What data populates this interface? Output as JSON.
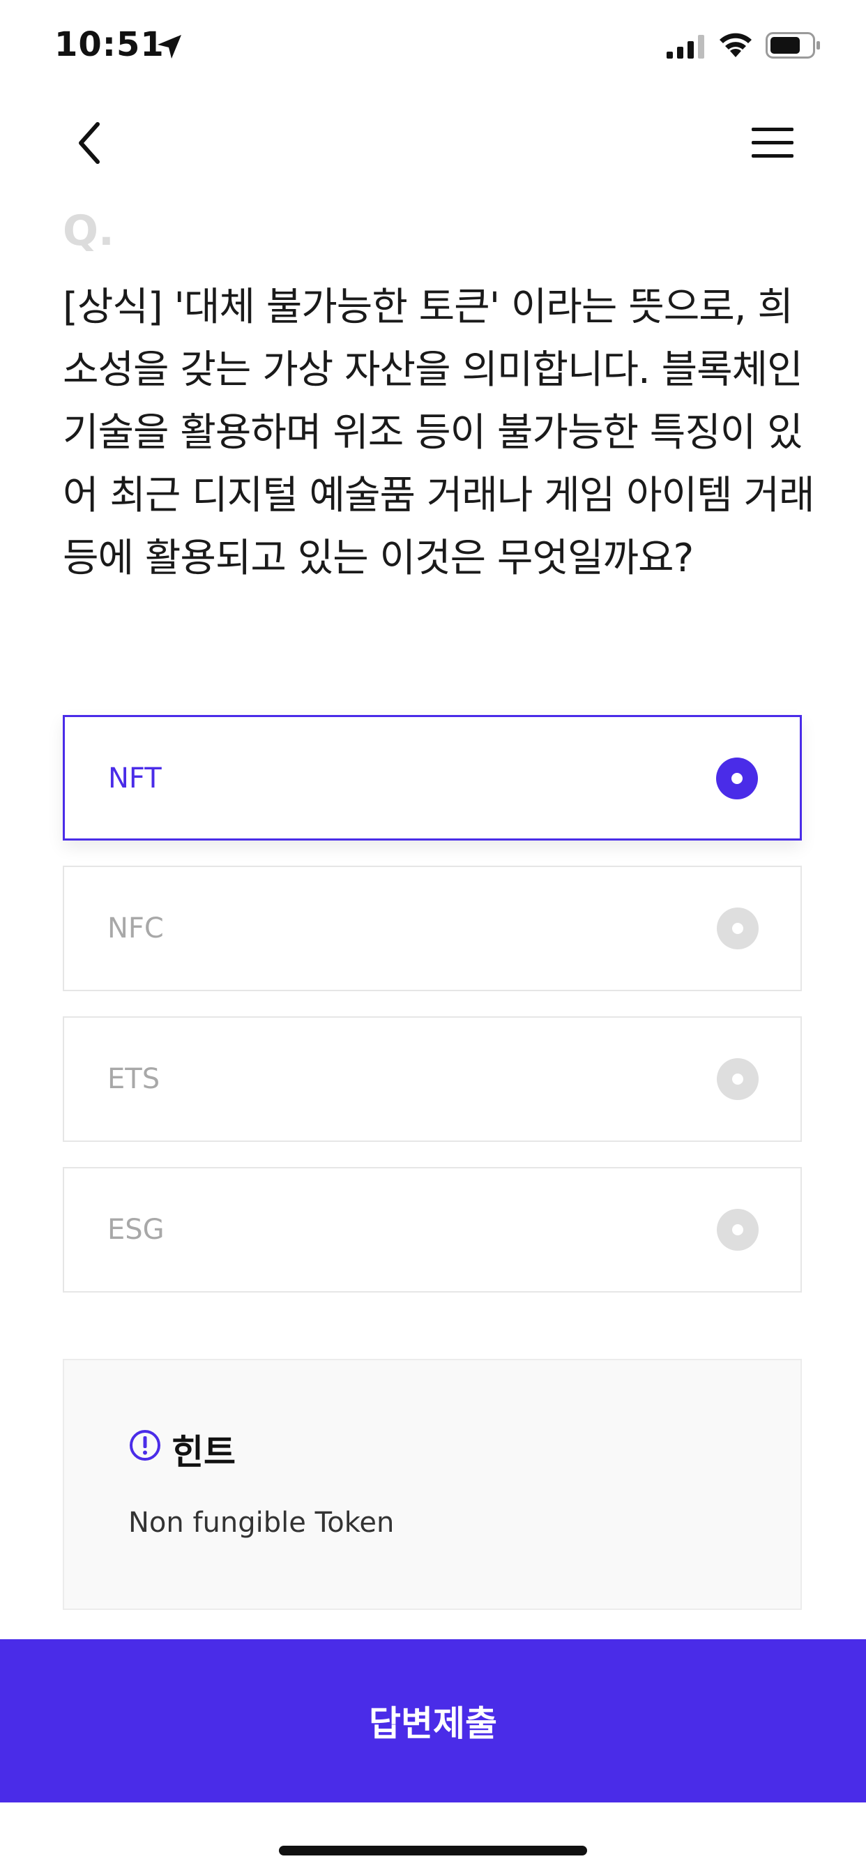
{
  "status_bar": {
    "time": "10:51"
  },
  "question": {
    "marker": "Q.",
    "text": "[상식] '대체 불가능한 토큰' 이라는 뜻으로, 희소성을 갖는 가상 자산을 의미합니다. 블록체인 기술을 활용하며 위조 등이 불가능한 특징이 있어 최근 디지털 예술품 거래나 게임 아이템 거래 등에 활용되고 있는 이것은 무엇일까요?"
  },
  "options": [
    {
      "label": "NFT",
      "selected": true
    },
    {
      "label": "NFC",
      "selected": false
    },
    {
      "label": "ETS",
      "selected": false
    },
    {
      "label": "ESG",
      "selected": false
    }
  ],
  "hint": {
    "title": "힌트",
    "text": "Non fungible Token"
  },
  "submit_label": "답변제출",
  "colors": {
    "accent": "#4a2ce8",
    "unselected": "#dedede"
  }
}
